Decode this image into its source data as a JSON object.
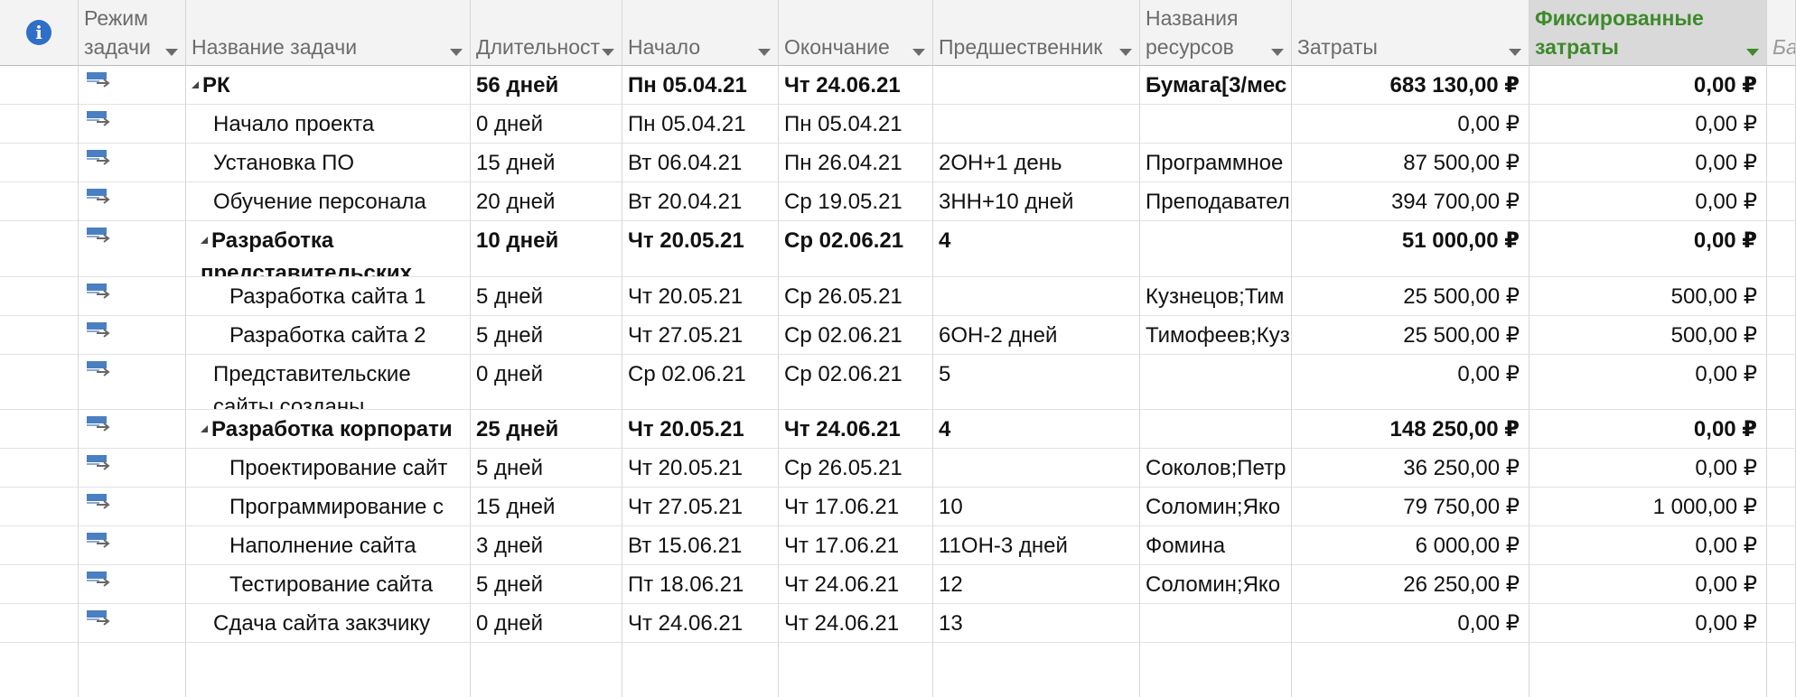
{
  "header": {
    "mode": "Режим\nзадачи",
    "name": "Название задачи",
    "duration": "Длительност",
    "start": "Начало",
    "finish": "Окончание",
    "pred": "Предшественник",
    "resources": "Названия\nресурсов",
    "cost": "Затраты",
    "fixed": "Фиксированные\nзатраты",
    "cut": "Баз"
  },
  "icons": {
    "info": "i",
    "mode": "auto-scheduled-task-icon"
  },
  "rows": [
    {
      "name": "РК",
      "dur": "56 дней",
      "start": "Пн 05.04.21",
      "finish": "Чт 24.06.21",
      "pred": "",
      "res": "Бумага[3/мес",
      "cost": "683 130,00 ₽",
      "fixed": "0,00 ₽"
    },
    {
      "name": "Начало проекта",
      "dur": "0 дней",
      "start": "Пн 05.04.21",
      "finish": "Пн 05.04.21",
      "pred": "",
      "res": "",
      "cost": "0,00 ₽",
      "fixed": "0,00 ₽"
    },
    {
      "name": "Установка ПО",
      "dur": "15 дней",
      "start": "Вт 06.04.21",
      "finish": "Пн 26.04.21",
      "pred": "2ОН+1 день",
      "res": "Программное",
      "cost": "87 500,00 ₽",
      "fixed": "0,00 ₽"
    },
    {
      "name": "Обучение персонала",
      "dur": "20 дней",
      "start": "Вт 20.04.21",
      "finish": "Ср 19.05.21",
      "pred": "3НН+10 дней",
      "res": "Преподавател",
      "cost": "394 700,00 ₽",
      "fixed": "0,00 ₽"
    },
    {
      "name": "Разработка представительских",
      "dur": "10 дней",
      "start": "Чт 20.05.21",
      "finish": "Ср 02.06.21",
      "pred": "4",
      "res": "",
      "cost": "51 000,00 ₽",
      "fixed": "0,00 ₽"
    },
    {
      "name": "Разработка сайта 1",
      "dur": "5 дней",
      "start": "Чт 20.05.21",
      "finish": "Ср 26.05.21",
      "pred": "",
      "res": "Кузнецов;Тим",
      "cost": "25 500,00 ₽",
      "fixed": "500,00 ₽"
    },
    {
      "name": "Разработка сайта 2",
      "dur": "5 дней",
      "start": "Чт 27.05.21",
      "finish": "Ср 02.06.21",
      "pred": "6ОН-2 дней",
      "res": "Тимофеев;Куз",
      "cost": "25 500,00 ₽",
      "fixed": "500,00 ₽"
    },
    {
      "name": "Представительские сайты созданы",
      "dur": "0 дней",
      "start": "Ср 02.06.21",
      "finish": "Ср 02.06.21",
      "pred": "5",
      "res": "",
      "cost": "0,00 ₽",
      "fixed": "0,00 ₽"
    },
    {
      "name": "Разработка корпорати",
      "dur": "25 дней",
      "start": "Чт 20.05.21",
      "finish": "Чт 24.06.21",
      "pred": "4",
      "res": "",
      "cost": "148 250,00 ₽",
      "fixed": "0,00 ₽"
    },
    {
      "name": "Проектирование сайт",
      "dur": "5 дней",
      "start": "Чт 20.05.21",
      "finish": "Ср 26.05.21",
      "pred": "",
      "res": "Соколов;Петр",
      "cost": "36 250,00 ₽",
      "fixed": "0,00 ₽"
    },
    {
      "name": "Программирование с",
      "dur": "15 дней",
      "start": "Чт 27.05.21",
      "finish": "Чт 17.06.21",
      "pred": "10",
      "res": "Соломин;Яко",
      "cost": "79 750,00 ₽",
      "fixed": "1 000,00 ₽"
    },
    {
      "name": "Наполнение сайта",
      "dur": "3 дней",
      "start": "Вт 15.06.21",
      "finish": "Чт 17.06.21",
      "pred": "11ОН-3 дней",
      "res": "Фомина",
      "cost": "6 000,00 ₽",
      "fixed": "0,00 ₽"
    },
    {
      "name": "Тестирование сайта",
      "dur": "5 дней",
      "start": "Пт 18.06.21",
      "finish": "Чт 24.06.21",
      "pred": "12",
      "res": "Соломин;Яко",
      "cost": "26 250,00 ₽",
      "fixed": "0,00 ₽"
    },
    {
      "name": "Сдача сайта закзчику",
      "dur": "0 дней",
      "start": "Чт 24.06.21",
      "finish": "Чт 24.06.21",
      "pred": "13",
      "res": "",
      "cost": "0,00 ₽",
      "fixed": "0,00 ₽"
    }
  ]
}
